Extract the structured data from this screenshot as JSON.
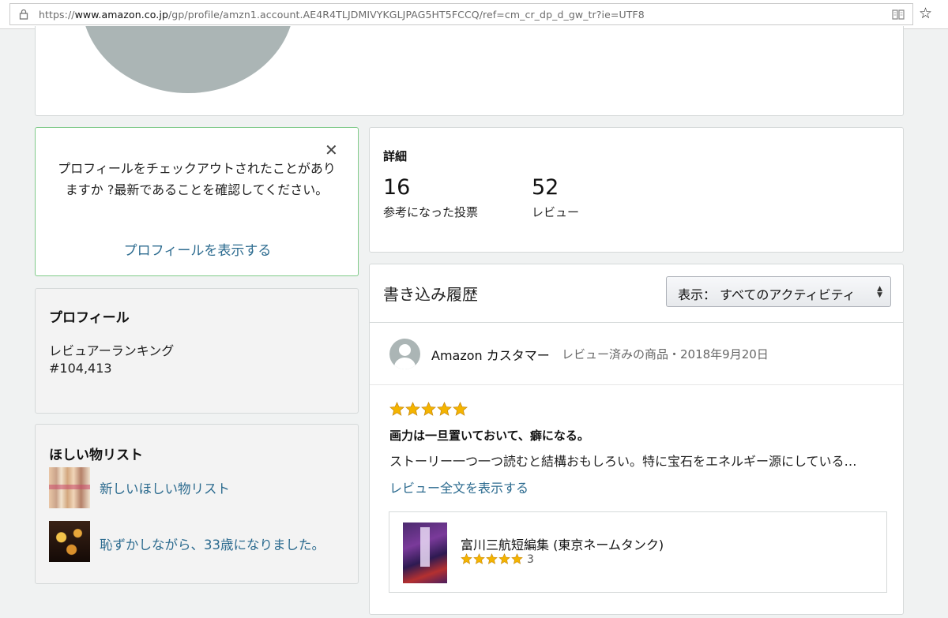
{
  "browser": {
    "url_prefix": "https://",
    "url_host": "www.amazon.co.jp",
    "url_path": "/gp/profile/amzn1.account.AE4R4TLJDMIVYKGLJPAG5HT5FCCQ/ref=cm_cr_dp_d_gw_tr?ie=UTF8",
    "star_glyph": "☆"
  },
  "notice": {
    "close_glyph": "✕",
    "message": "プロフィールをチェックアウトされたことがありますか ?最新であることを確認してください。",
    "link": "プロフィールを表示する"
  },
  "profile": {
    "title": "プロフィール",
    "ranking_label": "レビュアーランキング",
    "ranking_value": "#104,413"
  },
  "wishlist": {
    "title": "ほしい物リスト",
    "items": [
      {
        "label": "新しいほしい物リスト"
      },
      {
        "label": "恥ずかしながら、33歳になりました。"
      }
    ]
  },
  "details": {
    "title": "詳細",
    "stats": [
      {
        "value": "16",
        "label": "参考になった投票"
      },
      {
        "value": "52",
        "label": "レビュー"
      }
    ]
  },
  "history": {
    "title": "書き込み履歴",
    "filter_label": "表示：",
    "filter_value": "すべてのアクティビティ",
    "filter_arrow": "▲▼"
  },
  "review": {
    "reviewer": "Amazon カスタマー",
    "meta": "レビュー済みの商品・2018年9月20日",
    "rating": 5,
    "title": "画力は一旦置いておいて、癖になる。",
    "body": "ストーリー一つ一つ読むと結構おもしろい。特に宝石をエネルギー源にしている…",
    "more": "レビュー全文を表示する",
    "product": {
      "name": "富川三航短編集 (東京ネームタンク)",
      "rating": 5,
      "rating_count": "3"
    }
  },
  "colors": {
    "link": "#2c6b8f",
    "star": "#f4b400",
    "notice_border": "#7fca89",
    "avatar": "#abb5b5"
  }
}
